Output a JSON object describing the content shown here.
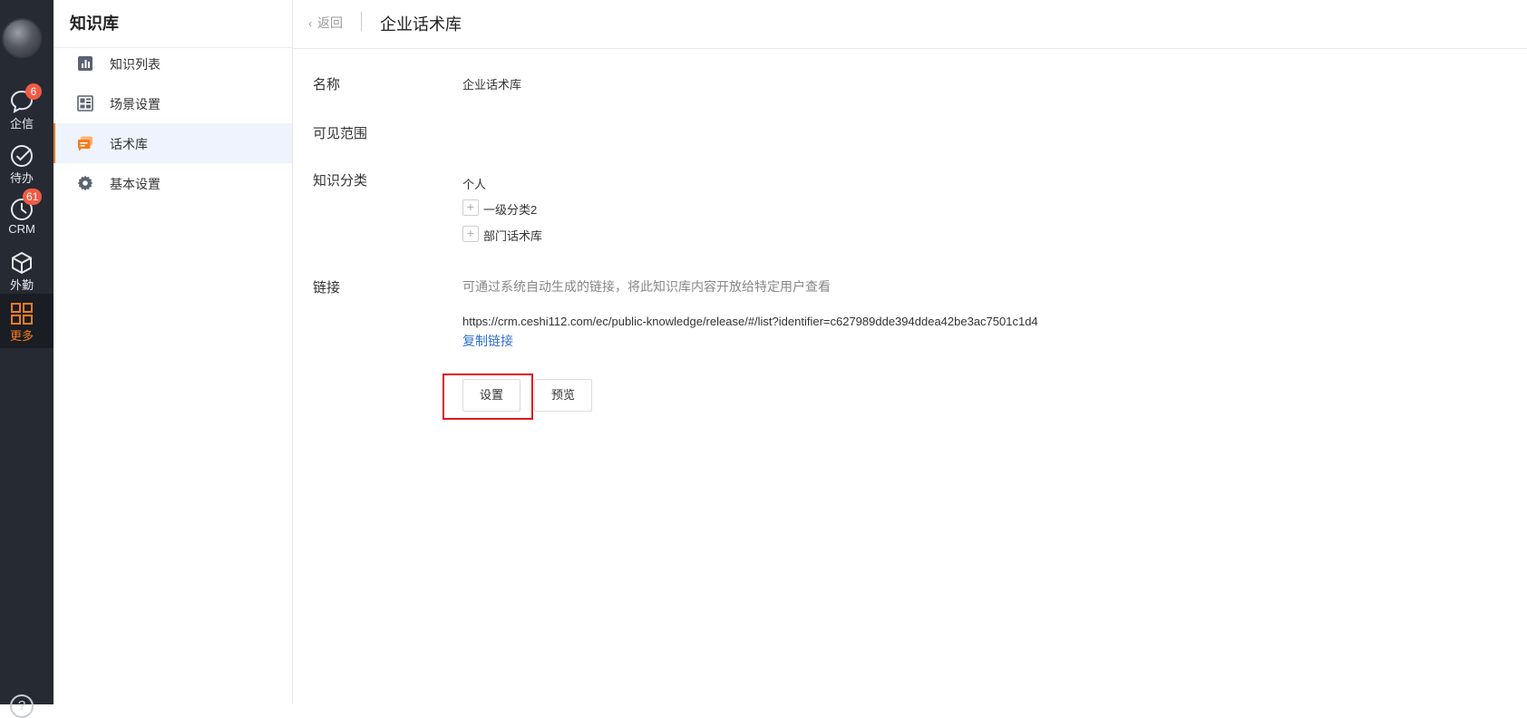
{
  "rail": {
    "items": [
      {
        "label": "企信",
        "icon": "chat-icon",
        "badge": "6"
      },
      {
        "label": "待办",
        "icon": "check-circle-icon",
        "badge": ""
      },
      {
        "label": "CRM",
        "icon": "clock-icon",
        "badge": "61"
      },
      {
        "label": "外勤",
        "icon": "cube-icon",
        "badge": ""
      },
      {
        "label": "更多",
        "icon": "grid-icon",
        "badge": ""
      }
    ],
    "help": "?",
    "accent": "#f57c1f"
  },
  "sidebar": {
    "title": "知识库",
    "items": [
      {
        "label": "知识列表",
        "icon": "bar-chart-icon"
      },
      {
        "label": "场景设置",
        "icon": "layout-icon"
      },
      {
        "label": "话术库",
        "icon": "speech-bubble-icon"
      },
      {
        "label": "基本设置",
        "icon": "gear-icon"
      }
    ]
  },
  "header": {
    "back_label": "返回",
    "title": "企业话术库"
  },
  "form": {
    "name_label": "名称",
    "name_value": "企业话术库",
    "scope_label": "可见范围",
    "category_label": "知识分类",
    "category_root": "个人",
    "category_children": [
      "一级分类2",
      "部门话术库"
    ],
    "link_label": "链接",
    "link_hint": "可通过系统自动生成的链接，将此知识库内容开放给特定用户查看",
    "link_url": "https://crm.ceshi112.com/ec/public-knowledge/release/#/list?identifier=c627989dde394ddea42be3ac7501c1d4",
    "copy_link_label": "复制链接",
    "settings_button": "设置",
    "preview_button": "预览"
  },
  "colors": {
    "rail_bg": "#262a33",
    "link_blue": "#2f6fd6",
    "badge_red": "#f35a45",
    "highlight_red": "#e0141e"
  }
}
